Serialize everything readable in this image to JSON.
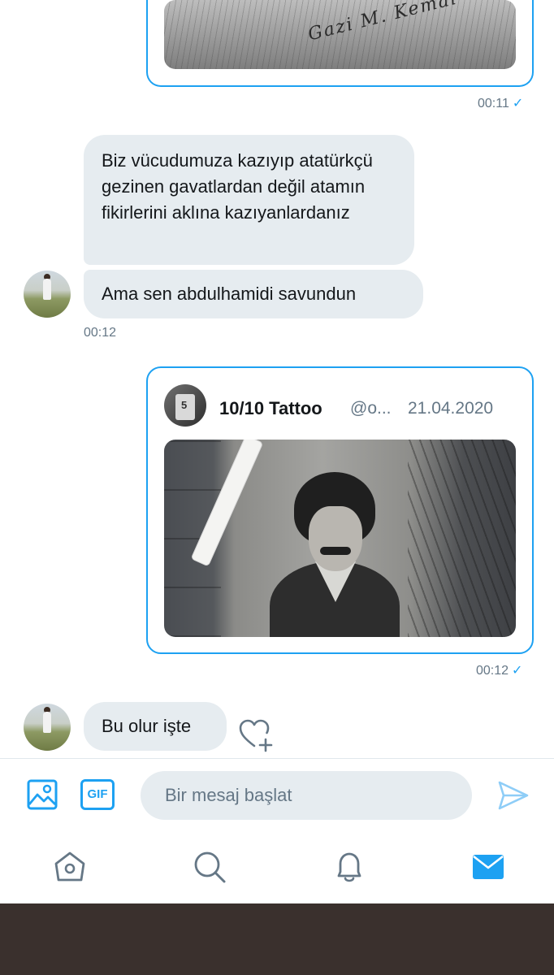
{
  "messages": {
    "top_card_timestamp": "00:11",
    "bubble_1_text": "Biz vücudumuza kazıyıp atatürkçü gezinen gavatlardan değil atamın fikirlerini aklına kazıyanlardanız",
    "bubble_2_text": "Ama sen abdulhamidi savundun",
    "group_timestamp": "00:12",
    "quoted_tweet": {
      "name": "10/10 Tattoo",
      "handle": "@o...",
      "date": "21.04.2020",
      "avatar_number": "5"
    },
    "quoted_timestamp": "00:12",
    "bubble_3_text": "Bu olur işte",
    "read_check": "✓"
  },
  "composer": {
    "gif_label": "GIF",
    "placeholder": "Bir mesaj başlat"
  },
  "icons": {
    "media": "image-icon",
    "gif": "gif-icon",
    "send": "send-icon",
    "react": "heart-add-icon",
    "home": "home-icon",
    "search": "search-icon",
    "notifications": "bell-icon",
    "messages": "mail-icon"
  },
  "colors": {
    "accent": "#1da1f2",
    "bubble": "#e6ecf0",
    "muted": "#657786",
    "bottom_bar": "#3a302d"
  }
}
